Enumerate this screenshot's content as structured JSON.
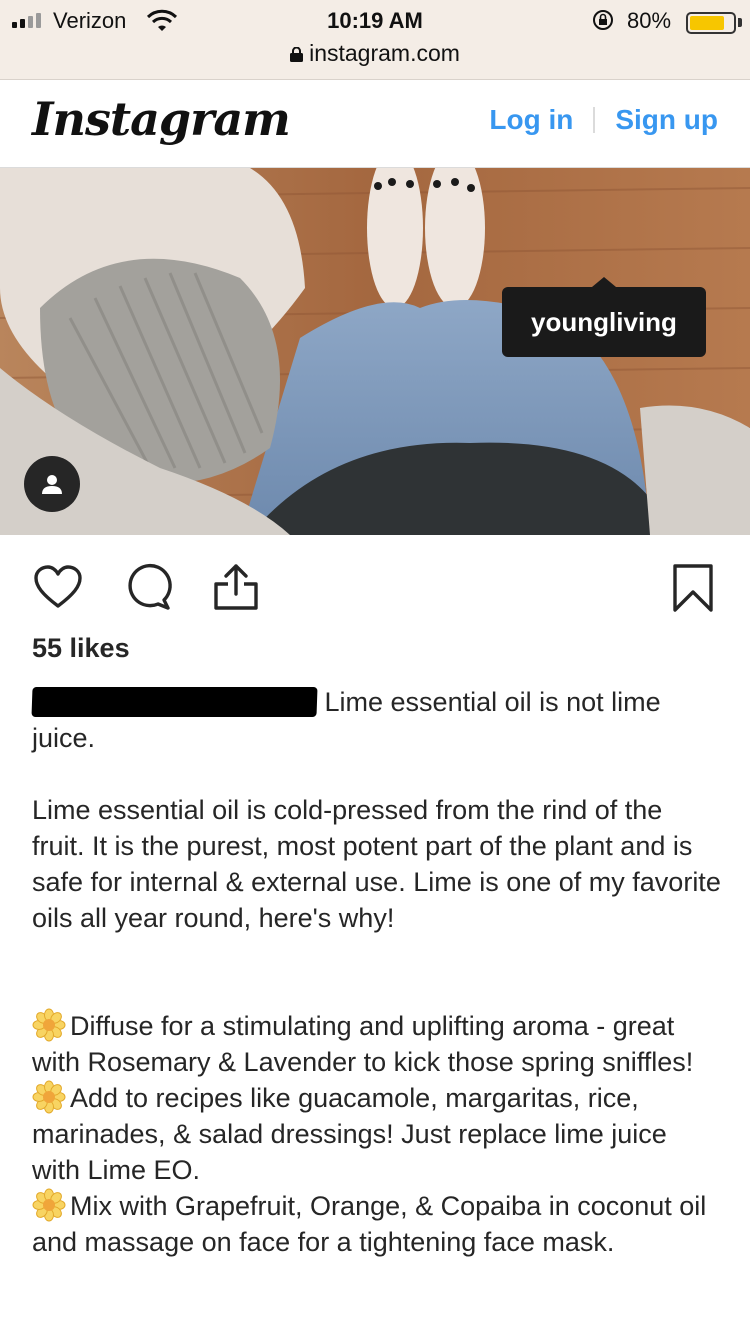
{
  "status_bar": {
    "carrier": "Verizon",
    "time": "10:19 AM",
    "battery_percent": "80%",
    "battery_level": 0.8,
    "url": "instagram.com"
  },
  "header": {
    "logo": "Instagram",
    "login_label": "Log in",
    "signup_label": "Sign up",
    "link_color": "#3897f0"
  },
  "post": {
    "photo_tag": "youngliving",
    "likes": "55 likes",
    "caption_lead": "Lime essential oil is not lime juice.",
    "caption_body": "Lime essential oil is cold-pressed from the rind of the fruit. It is the purest, most potent part of the plant and is safe for internal & external use. Lime is one of my favorite oils all year round, here's why!",
    "tips": [
      {
        "icon": "flower-emoji",
        "text": "Diffuse for a stimulating and uplifting aroma - great with Rosemary & Lavender to kick those spring sniffles!"
      },
      {
        "icon": "flower-emoji",
        "text": "Add to recipes like guacamole, margaritas, rice, marinades, & salad dressings! Just replace lime juice with Lime EO."
      },
      {
        "icon": "flower-emoji",
        "text": "Mix with Grapefruit, Orange, & Copaiba in coconut oil and massage on face for a tightening face mask."
      }
    ]
  },
  "icons": {
    "like": "heart-icon",
    "comment": "comment-icon",
    "share": "share-icon",
    "save": "bookmark-icon",
    "user_tags": "person-icon"
  }
}
